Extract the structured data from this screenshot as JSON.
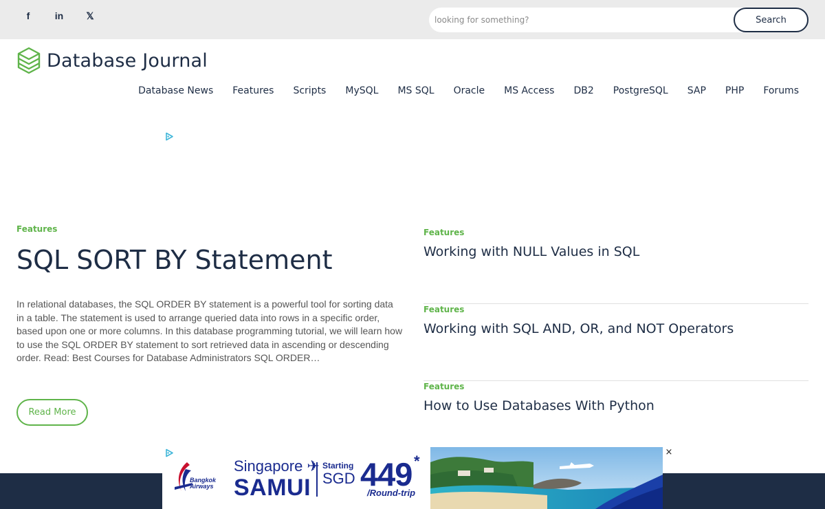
{
  "topbar": {
    "social": [
      {
        "icon": "facebook-icon",
        "glyph": "f"
      },
      {
        "icon": "linkedin-icon",
        "glyph": "in"
      },
      {
        "icon": "x-twitter-icon",
        "glyph": "𝕏"
      }
    ],
    "search": {
      "placeholder": "looking for something?",
      "button_label": "Search"
    }
  },
  "header": {
    "logo_text": "Database Journal",
    "logo_color": "#5fb44a"
  },
  "nav": {
    "items": [
      "Database News",
      "Features",
      "Scripts",
      "MySQL",
      "MS SQL",
      "Oracle",
      "MS Access",
      "DB2",
      "PostgreSQL",
      "SAP",
      "PHP",
      "Forums"
    ]
  },
  "featured": {
    "category": "Features",
    "title": "SQL SORT BY Statement",
    "excerpt": "In relational databases, the SQL ORDER BY statement is a powerful tool for sorting data in a table. The statement is used to arrange queried data into rows in a specific order, based upon one or more columns. In this database programming tutorial, we will learn how to use the SQL ORDER BY statement to sort retrieved data in ascending or descending order. Read: Best Courses for Database Administrators SQL ORDER…",
    "read_more_label": "Read More"
  },
  "side_articles": [
    {
      "category": "Features",
      "title": "Working with NULL Values in SQL"
    },
    {
      "category": "Features",
      "title": "Working with SQL AND, OR, and NOT Operators"
    },
    {
      "category": "Features",
      "title": "How to Use Databases With Python"
    }
  ],
  "ad": {
    "brand": "Bangkok Airways",
    "dest_top": "Singapore",
    "dest_main": "SAMUI",
    "starting": "Starting",
    "currency": "SGD",
    "price": "449",
    "asterisk": "*",
    "round_trip": "/Round-trip",
    "close": "×"
  },
  "colors": {
    "accent_green": "#5fb44a",
    "navy": "#1e2d45",
    "topbar_bg": "#ebebeb"
  }
}
